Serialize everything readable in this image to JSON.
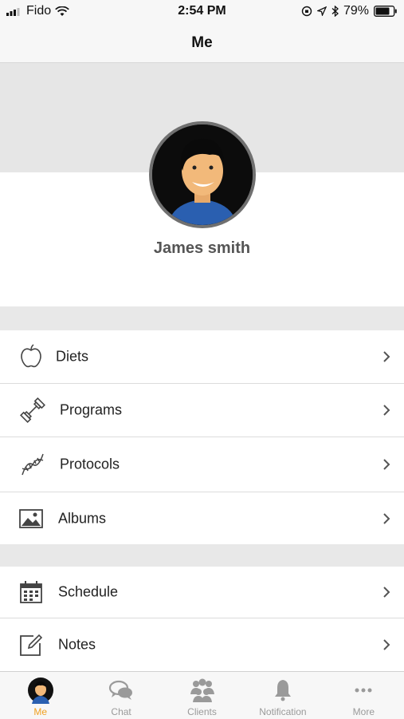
{
  "status_bar": {
    "carrier": "Fido",
    "time": "2:54 PM",
    "battery": "79%"
  },
  "nav": {
    "title": "Me"
  },
  "profile": {
    "name": "James smith"
  },
  "menu_group_1": [
    {
      "label": "Diets",
      "icon": "apple-icon"
    },
    {
      "label": "Programs",
      "icon": "dumbbell-icon"
    },
    {
      "label": "Protocols",
      "icon": "dna-icon"
    },
    {
      "label": "Albums",
      "icon": "image-icon"
    }
  ],
  "menu_group_2": [
    {
      "label": "Schedule",
      "icon": "calendar-icon"
    },
    {
      "label": "Notes",
      "icon": "notes-icon"
    }
  ],
  "tabs": [
    {
      "label": "Me",
      "icon": "avatar-icon",
      "active": true
    },
    {
      "label": "Chat",
      "icon": "chat-icon",
      "active": false
    },
    {
      "label": "Clients",
      "icon": "clients-icon",
      "active": false
    },
    {
      "label": "Notification",
      "icon": "bell-icon",
      "active": false
    },
    {
      "label": "More",
      "icon": "more-icon",
      "active": false
    }
  ],
  "colors": {
    "accent": "#f0a020",
    "inactive": "#9a9a9a",
    "separator": "#e8e8e8"
  }
}
